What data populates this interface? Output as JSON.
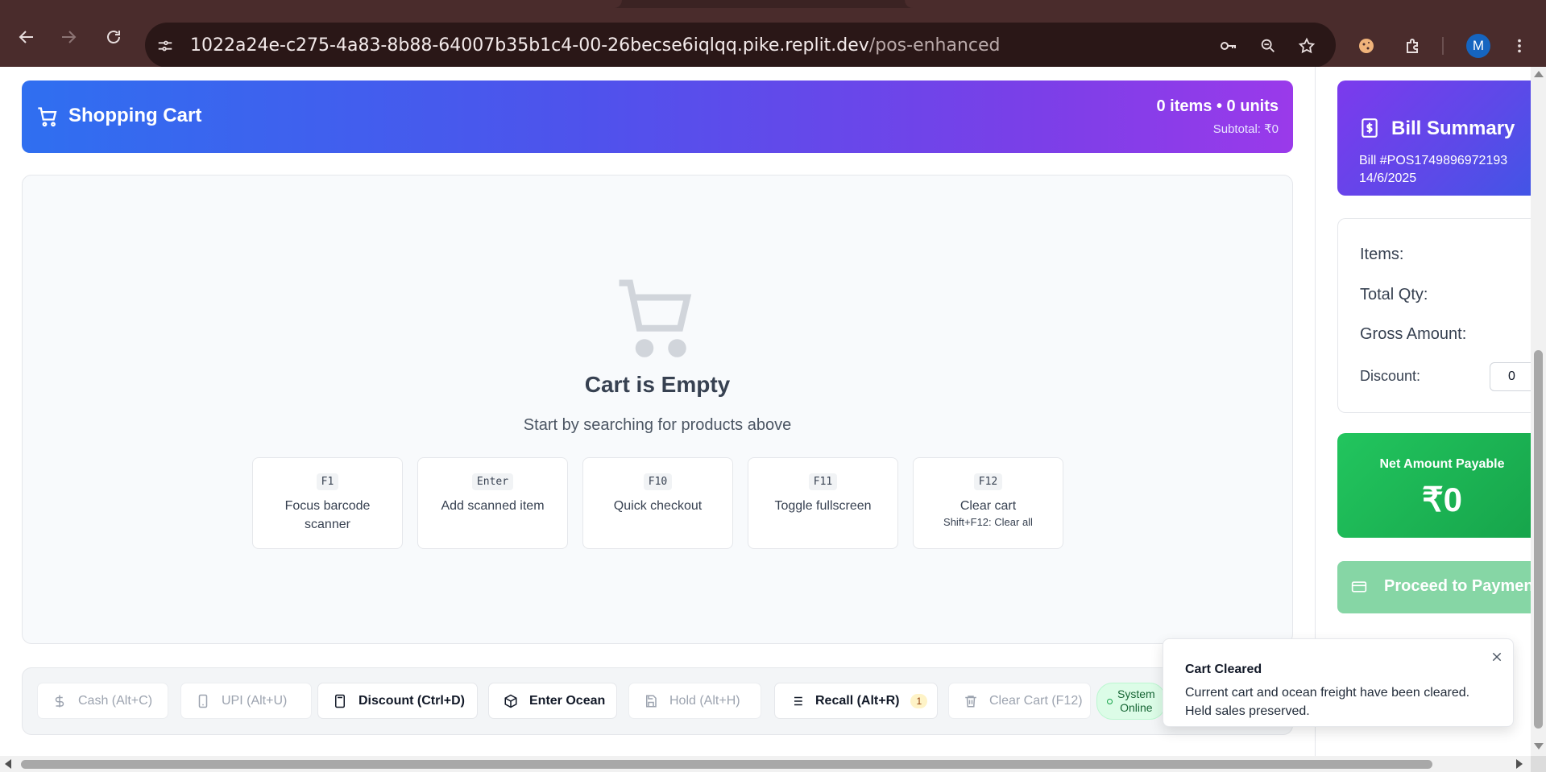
{
  "browser": {
    "url_host": "1022a24e-c275-4a83-8b88-64007b35b1c4-00-26becse6iqlqq.pike.replit.dev",
    "url_path": "/pos-enhanced",
    "profile_initial": "M"
  },
  "cart": {
    "title": "Shopping Cart",
    "summary": "0 items • 0 units",
    "subtotal": "Subtotal: ₹0",
    "empty_title": "Cart is Empty",
    "empty_subtitle": "Start by searching for products above",
    "shortcuts": [
      {
        "key": "F1",
        "label": "Focus barcode scanner",
        "note": ""
      },
      {
        "key": "Enter",
        "label": "Add scanned item",
        "note": ""
      },
      {
        "key": "F10",
        "label": "Quick checkout",
        "note": ""
      },
      {
        "key": "F11",
        "label": "Toggle fullscreen",
        "note": ""
      },
      {
        "key": "F12",
        "label": "Clear cart",
        "note": "Shift+F12: Clear all"
      }
    ]
  },
  "actions": {
    "cash": "Cash (Alt+C)",
    "upi": "UPI (Alt+U)",
    "discount": "Discount (Ctrl+D)",
    "ocean": "Enter Ocean",
    "hold": "Hold (Alt+H)",
    "recall": "Recall (Alt+R)",
    "recall_count": "1",
    "clear": "Clear Cart (F12)",
    "status_line1": "System",
    "status_line2": "Online"
  },
  "bill": {
    "title": "Bill Summary",
    "bill_number": "Bill #POS1749896972193",
    "date": "14/6/2025",
    "items_label": "Items:",
    "total_qty_label": "Total Qty:",
    "gross_label": "Gross Amount:",
    "discount_label": "Discount:",
    "discount_value": "0",
    "net_label": "Net Amount Payable",
    "net_amount": "₹0",
    "proceed_label": "Proceed to Paymen"
  },
  "toast": {
    "title": "Cart Cleared",
    "message": "Current cart and ocean freight have been cleared. Held sales preserved."
  },
  "colors": {
    "cart_header_gradient": [
      "#2f6ff0",
      "#9a3aea"
    ],
    "net_card": "#22c55e",
    "proceed_disabled": "#86d6a5",
    "chrome": "#4a2c2c"
  }
}
